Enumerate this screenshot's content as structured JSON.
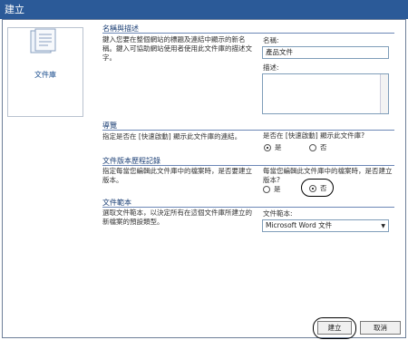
{
  "window": {
    "title": "建立"
  },
  "left": {
    "label": "文件庫"
  },
  "name_section": {
    "title": "名稱與描述",
    "description": "鍵入您要在整個網站的標題及連結中顯示的新名稱。鍵入可協助網站使用者使用此文件庫的描述文字。",
    "name_label": "名稱:",
    "name_value": "產品文件",
    "desc_label": "描述:",
    "desc_value": ""
  },
  "nav_section": {
    "title": "導覽",
    "description": "指定是否在 [快速啟動] 顯示此文件庫的連結。",
    "question": "是否在 [快速啟動] 顯示此文件庫?",
    "yes_label": "是",
    "no_label": "否",
    "selected": "yes"
  },
  "version_section": {
    "title": "文件版本歷程記錄",
    "description": "指定每當您編輯此文件庫中的檔案時，是否要建立版本。",
    "question": "每當您編輯此文件庫中的檔案時，是否建立版本?",
    "yes_label": "是",
    "no_label": "否",
    "selected": "no"
  },
  "template_section": {
    "title": "文件範本",
    "description": "選取文件範本，以決定所有在這個文件庫所建立的新檔案的預設類型。",
    "label": "文件範本:",
    "selected_value": "Microsoft Word 文件"
  },
  "buttons": {
    "create": "建立",
    "cancel": "取消"
  }
}
